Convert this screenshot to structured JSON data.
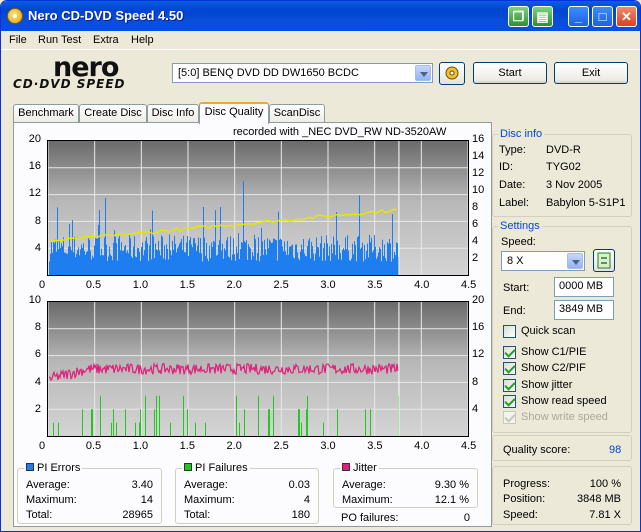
{
  "window": {
    "title": "Nero CD-DVD Speed 4.50"
  },
  "menu": [
    "File",
    "Run Test",
    "Extra",
    "Help"
  ],
  "logo": {
    "main": "nero",
    "sub": "CD·DVD SPEED"
  },
  "drive": {
    "selected": "[5:0]  BENQ DVD DD DW1650 BCDC"
  },
  "buttons": {
    "start": "Start",
    "exit": "Exit"
  },
  "tabs": [
    "Benchmark",
    "Create Disc",
    "Disc Info",
    "Disc Quality",
    "ScanDisc"
  ],
  "active_tab": "Disc Quality",
  "recorded_with": "recorded with _NEC     DVD_RW ND-3520AW",
  "disc_info": {
    "title": "Disc info",
    "type_label": "Type:",
    "type": "DVD-R",
    "id_label": "ID:",
    "id": "TYG02",
    "date_label": "Date:",
    "date": "3 Nov 2005",
    "label_label": "Label:",
    "label": "Babylon 5-S1P1"
  },
  "settings": {
    "title": "Settings",
    "speed_label": "Speed:",
    "speed": "8 X",
    "start_label": "Start:",
    "start": "0000 MB",
    "end_label": "End:",
    "end": "3849 MB",
    "checkboxes": [
      {
        "label": "Quick scan",
        "checked": false,
        "enabled": true
      },
      {
        "label": "Show C1/PIE",
        "checked": true,
        "enabled": true
      },
      {
        "label": "Show C2/PIF",
        "checked": true,
        "enabled": true
      },
      {
        "label": "Show jitter",
        "checked": true,
        "enabled": true
      },
      {
        "label": "Show read speed",
        "checked": true,
        "enabled": true
      },
      {
        "label": "Show write speed",
        "checked": true,
        "enabled": false
      }
    ]
  },
  "quality": {
    "label": "Quality score:",
    "value": "98"
  },
  "progress": {
    "progress_label": "Progress:",
    "progress": "100 %",
    "position_label": "Position:",
    "position": "3848 MB",
    "speed_label": "Speed:",
    "speed": "7.81 X"
  },
  "stats": {
    "pi_errors": {
      "title": "PI Errors",
      "color": "#1e7ef0",
      "average_label": "Average:",
      "average": "3.40",
      "maximum_label": "Maximum:",
      "maximum": "14",
      "total_label": "Total:",
      "total": "28965"
    },
    "pi_failures": {
      "title": "PI Failures",
      "color": "#22c822",
      "average_label": "Average:",
      "average": "0.03",
      "maximum_label": "Maximum:",
      "maximum": "4",
      "total_label": "Total:",
      "total": "180"
    },
    "jitter": {
      "title": "Jitter",
      "color": "#e0207a",
      "average_label": "Average:",
      "average": "9.30 %",
      "maximum_label": "Maximum:",
      "maximum": "12.1 %"
    },
    "po_label": "PO failures:",
    "po": "0"
  },
  "chart_data": [
    {
      "type": "bar",
      "name": "PI Errors / read speed",
      "x_ticks": [
        "0",
        "0.5",
        "1.0",
        "1.5",
        "2.0",
        "2.5",
        "3.0",
        "3.5",
        "4.0",
        "4.5"
      ],
      "y_left_ticks": [
        "20",
        "16",
        "12",
        "8",
        "4"
      ],
      "y_right_ticks": [
        "16",
        "14",
        "12",
        "10",
        "8",
        "6",
        "4",
        "2"
      ],
      "xlim": [
        0,
        4.5
      ],
      "ylim_left": [
        0,
        20
      ],
      "ylim_right": [
        0,
        16
      ],
      "disc_end": 3.76,
      "pi_errors_typical": [
        2,
        6
      ],
      "pi_errors_max": 14,
      "read_speed": {
        "start": 4.0,
        "end": 7.8
      },
      "colors": {
        "pi": "#1e7ef0",
        "speed": "#e6e600"
      }
    },
    {
      "type": "bar",
      "name": "PI Failures / jitter",
      "x_ticks": [
        "0",
        "0.5",
        "1.0",
        "1.5",
        "2.0",
        "2.5",
        "3.0",
        "3.5",
        "4.0",
        "4.5"
      ],
      "y_left_ticks": [
        "10",
        "8",
        "6",
        "4",
        "2"
      ],
      "y_right_ticks": [
        "20",
        "16",
        "12",
        "8",
        "4"
      ],
      "xlim": [
        0,
        4.5
      ],
      "ylim_left": [
        0,
        10
      ],
      "ylim_right": [
        0,
        20
      ],
      "disc_end": 3.76,
      "pi_failures_max": 4,
      "jitter_range": [
        8.5,
        12.1
      ],
      "colors": {
        "pif": "#22c822",
        "jitter": "#e0207a"
      }
    }
  ]
}
